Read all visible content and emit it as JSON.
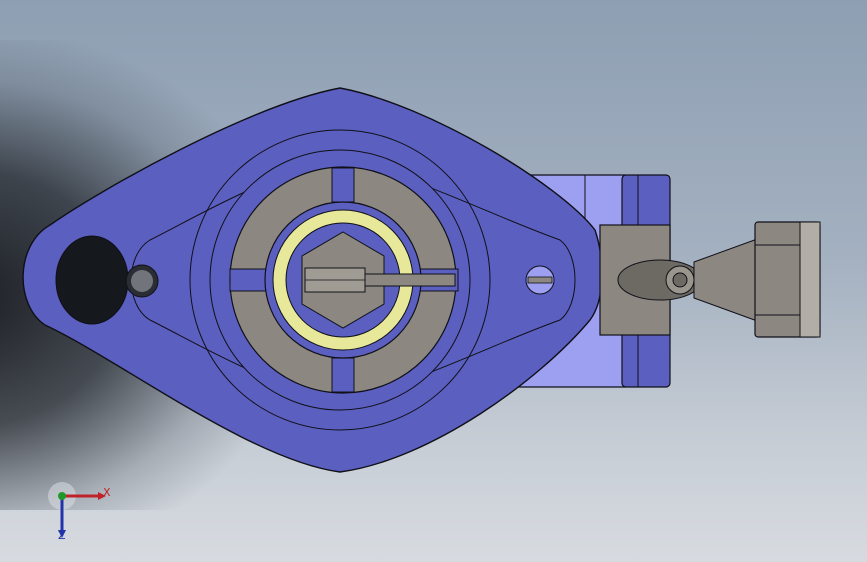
{
  "viewport": {
    "colors": {
      "background_top": "#8e9fb3",
      "background_bottom": "#d7dbe0",
      "housing": "#5b5fc0",
      "housing_light": "#9d9ff0",
      "insert": "#8c8780",
      "bearing_ring": "#e7e89a",
      "edge": "#101018"
    }
  },
  "triad": {
    "x_label": "X",
    "z_label": "Z",
    "x_color": "#c0222a",
    "y_color": "#1f9a2a",
    "z_color": "#2233aa"
  }
}
